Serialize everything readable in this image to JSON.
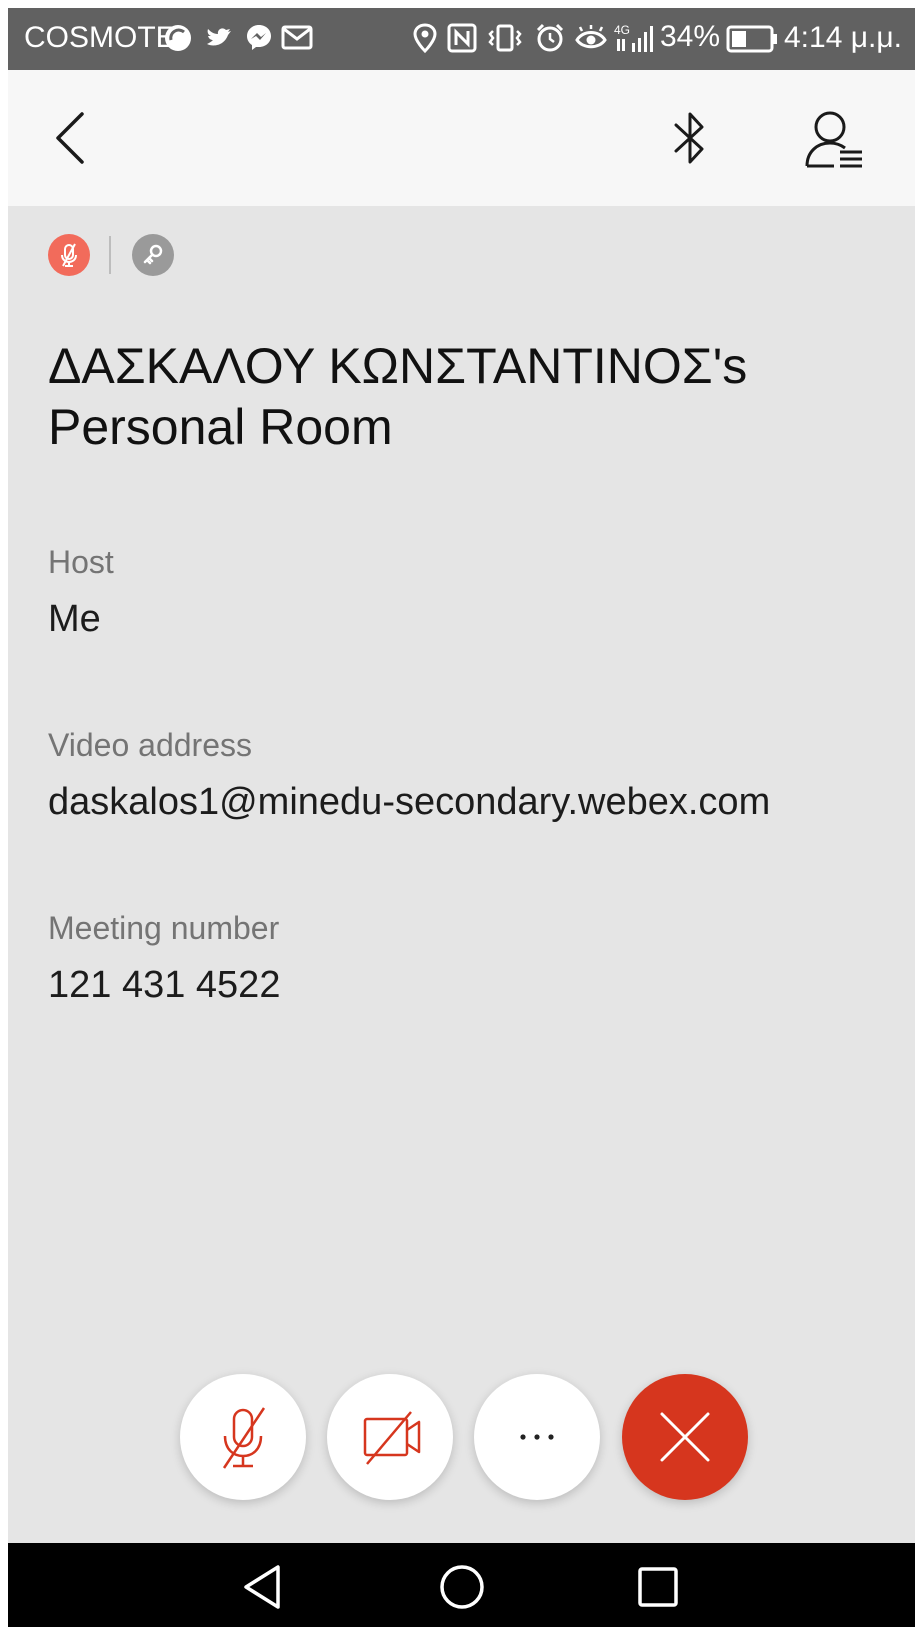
{
  "status_bar": {
    "carrier": "COSMOTE",
    "battery_percent": "34%",
    "time": "4:14 μ.μ.",
    "icons": [
      "sync-icon",
      "twitter-icon",
      "messenger-icon",
      "gmail-icon",
      "location-icon",
      "nfc-icon",
      "vibrate-icon",
      "alarm-icon",
      "eye-comfort-icon",
      "signal-4g-icon",
      "battery-icon"
    ]
  },
  "header": {
    "icons": [
      "back-arrow-icon",
      "bluetooth-icon",
      "participants-icon"
    ]
  },
  "indicators": {
    "icons": [
      "muted-indicator-icon",
      "locked-indicator-icon"
    ]
  },
  "meeting": {
    "title": "ΔΑΣΚΑΛΟΥ ΚΩΝΣΤΑΝΤΙΝΟΣ's Personal Room",
    "host_label": "Host",
    "host_value": "Me",
    "video_label": "Video address",
    "video_value": "daskalos1@minedu-secondary.webex.com",
    "number_label": "Meeting number",
    "number_value": "121 431 4522"
  },
  "controls": {
    "icons": [
      "mic-muted-icon",
      "video-off-icon",
      "more-icon",
      "close-icon"
    ]
  },
  "colors": {
    "status_bar": "#616161",
    "header_bg": "#f7f7f7",
    "content_bg": "#e5e5e5",
    "accent_red": "#d6361e",
    "muted_badge": "#f26b5b"
  },
  "nav": {
    "icons": [
      "nav-back-icon",
      "nav-home-icon",
      "nav-recents-icon"
    ]
  }
}
